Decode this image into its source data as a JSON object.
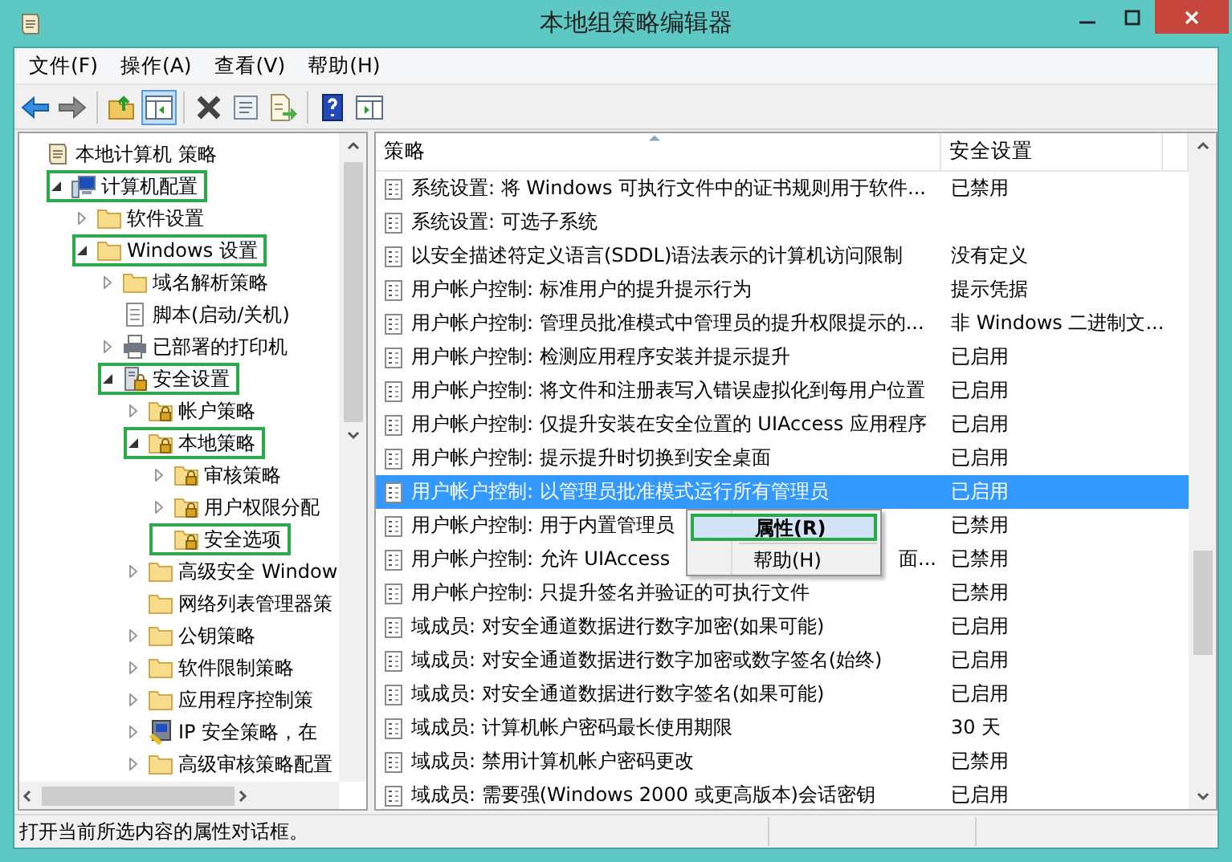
{
  "window": {
    "title": "本地组策略编辑器"
  },
  "menu": [
    "文件(F)",
    "操作(A)",
    "查看(V)",
    "帮助(H)"
  ],
  "toolbar": [
    {
      "kind": "back",
      "pressed": false
    },
    {
      "kind": "forward",
      "pressed": false
    },
    {
      "kind": "separator"
    },
    {
      "kind": "up",
      "pressed": false
    },
    {
      "kind": "tree",
      "pressed": true
    },
    {
      "kind": "separator"
    },
    {
      "kind": "delete",
      "pressed": false
    },
    {
      "kind": "properties",
      "pressed": false
    },
    {
      "kind": "export",
      "pressed": false
    },
    {
      "kind": "separator"
    },
    {
      "kind": "help",
      "pressed": false
    },
    {
      "kind": "pane",
      "pressed": false
    }
  ],
  "tree": [
    {
      "label": "本地计算机 策略",
      "kind": "policy",
      "highlighted": false,
      "children": [
        {
          "label": "计算机配置",
          "kind": "computer",
          "expanded": true,
          "highlighted": true,
          "children": [
            {
              "label": "软件设置",
              "kind": "folder",
              "expanded": false,
              "highlighted": false
            },
            {
              "label": "Windows 设置",
              "kind": "folder",
              "expanded": true,
              "highlighted": true,
              "children": [
                {
                  "label": "域名解析策略",
                  "kind": "folder",
                  "expanded": false,
                  "highlighted": false
                },
                {
                  "label": "脚本(启动/关机)",
                  "kind": "script",
                  "highlighted": false
                },
                {
                  "label": "已部署的打印机",
                  "kind": "printer",
                  "expanded": false,
                  "highlighted": false
                },
                {
                  "label": "安全设置",
                  "kind": "security",
                  "expanded": true,
                  "highlighted": true,
                  "children": [
                    {
                      "label": "帐户策略",
                      "kind": "lock-folder",
                      "expanded": false,
                      "highlighted": false
                    },
                    {
                      "label": "本地策略",
                      "kind": "lock-folder",
                      "expanded": true,
                      "highlighted": true,
                      "children": [
                        {
                          "label": "审核策略",
                          "kind": "lock-folder",
                          "expanded": false,
                          "highlighted": false
                        },
                        {
                          "label": "用户权限分配",
                          "kind": "lock-folder",
                          "expanded": false,
                          "highlighted": false
                        },
                        {
                          "label": "安全选项",
                          "kind": "lock-folder",
                          "highlighted": true
                        }
                      ]
                    },
                    {
                      "label": "高级安全 Window",
                      "kind": "folder",
                      "expanded": false,
                      "highlighted": false
                    },
                    {
                      "label": "网络列表管理器策",
                      "kind": "folder",
                      "highlighted": false
                    },
                    {
                      "label": "公钥策略",
                      "kind": "folder",
                      "expanded": false,
                      "highlighted": false
                    },
                    {
                      "label": "软件限制策略",
                      "kind": "folder",
                      "expanded": false,
                      "highlighted": false
                    },
                    {
                      "label": "应用程序控制策",
                      "kind": "folder",
                      "expanded": false,
                      "highlighted": false
                    },
                    {
                      "label": "IP 安全策略，在",
                      "kind": "ip",
                      "expanded": false,
                      "highlighted": false
                    },
                    {
                      "label": "高级审核策略配置",
                      "kind": "folder",
                      "expanded": false,
                      "highlighted": false
                    }
                  ]
                }
              ]
            }
          ]
        }
      ]
    }
  ],
  "table": {
    "columns": [
      "策略",
      "安全设置"
    ],
    "rows": [
      {
        "policy": "系统设置: 将 Windows 可执行文件中的证书规则用于软件...",
        "setting": "已禁用",
        "selected": false
      },
      {
        "policy": "系统设置: 可选子系统",
        "selected": false
      },
      {
        "policy": "以安全描述符定义语言(SDDL)语法表示的计算机访问限制",
        "setting": "没有定义",
        "selected": false
      },
      {
        "policy": "用户帐户控制: 标准用户的提升提示行为",
        "setting": "提示凭据",
        "selected": false
      },
      {
        "policy": "用户帐户控制: 管理员批准模式中管理员的提升权限提示的...",
        "setting": "非 Windows 二进制文...",
        "selected": false
      },
      {
        "policy": "用户帐户控制: 检测应用程序安装并提示提升",
        "setting": "已启用",
        "selected": false
      },
      {
        "policy": "用户帐户控制: 将文件和注册表写入错误虚拟化到每用户位置",
        "setting": "已启用",
        "selected": false
      },
      {
        "policy": "用户帐户控制: 仅提升安装在安全位置的 UIAccess 应用程序",
        "setting": "已启用",
        "selected": false
      },
      {
        "policy": "用户帐户控制: 提示提升时切换到安全桌面",
        "setting": "已启用",
        "selected": false
      },
      {
        "policy": "用户帐户控制: 以管理员批准模式运行所有管理员",
        "setting": "已启用",
        "selected": true
      },
      {
        "policy": "用户帐户控制: 用于内置管理员",
        "setting": "已禁用",
        "selected": false
      },
      {
        "policy": "用户帐户控制: 允许 UIAccess",
        "policy_tail": "面...",
        "setting": "已禁用",
        "selected": false
      },
      {
        "policy": "用户帐户控制: 只提升签名并验证的可执行文件",
        "setting": "已禁用",
        "selected": false
      },
      {
        "policy": "域成员: 对安全通道数据进行数字加密(如果可能)",
        "setting": "已启用",
        "selected": false
      },
      {
        "policy": "域成员: 对安全通道数据进行数字加密或数字签名(始终)",
        "setting": "已启用",
        "selected": false
      },
      {
        "policy": "域成员: 对安全通道数据进行数字签名(如果可能)",
        "setting": "已启用",
        "selected": false
      },
      {
        "policy": "域成员: 计算机帐户密码最长使用期限",
        "setting": "30 天",
        "selected": false
      },
      {
        "policy": "域成员: 禁用计算机帐户密码更改",
        "setting": "已禁用",
        "selected": false
      },
      {
        "policy": "域成员: 需要强(Windows 2000 或更高版本)会话密钥",
        "setting": "已启用",
        "selected": false
      }
    ]
  },
  "context_menu": {
    "items": [
      {
        "label": "属性(R)",
        "default": true,
        "highlighted": true,
        "annotated": true
      },
      {
        "label": "帮助(H)",
        "default": false,
        "highlighted": false,
        "annotated": false
      }
    ]
  },
  "status_bar": {
    "text": "打开当前所选内容的属性对话框。"
  }
}
